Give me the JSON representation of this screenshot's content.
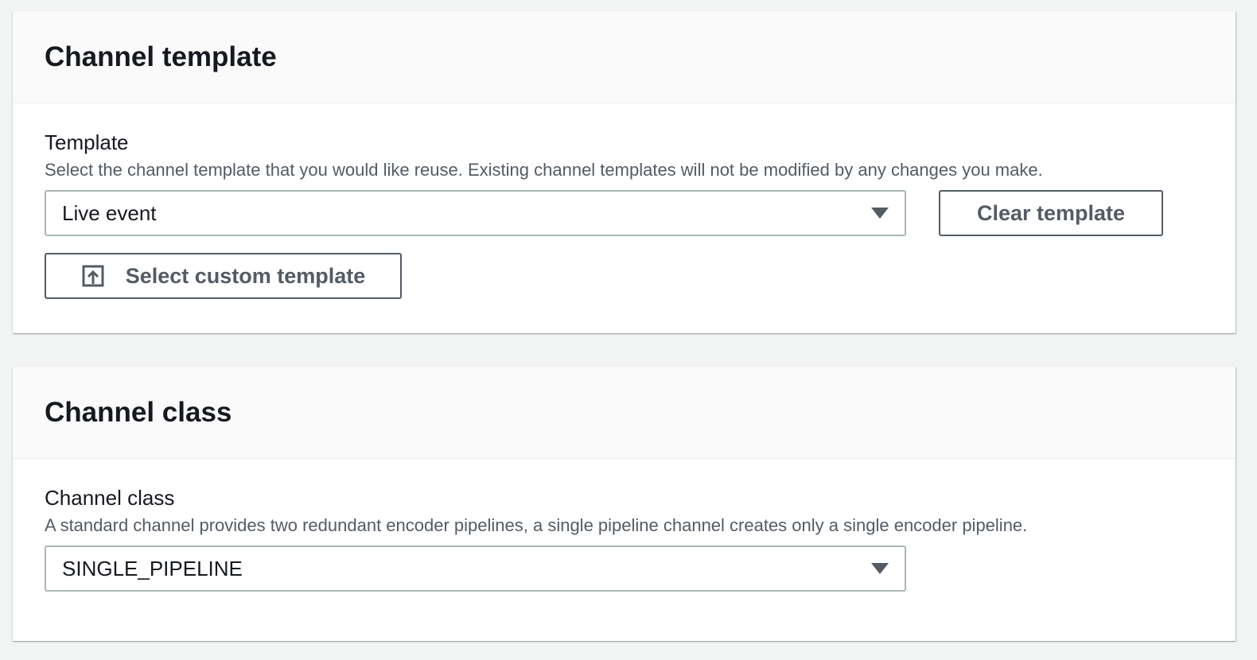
{
  "template_card": {
    "title": "Channel template",
    "label": "Template",
    "description": "Select the channel template that you would like reuse. Existing channel templates will not be modified by any changes you make.",
    "selected": "Live event",
    "clear_button": "Clear template",
    "custom_button": "Select custom template"
  },
  "class_card": {
    "title": "Channel class",
    "label": "Channel class",
    "description": "A standard channel provides two redundant encoder pipelines, a single pipeline channel creates only a single encoder pipeline.",
    "selected": "SINGLE_PIPELINE"
  }
}
